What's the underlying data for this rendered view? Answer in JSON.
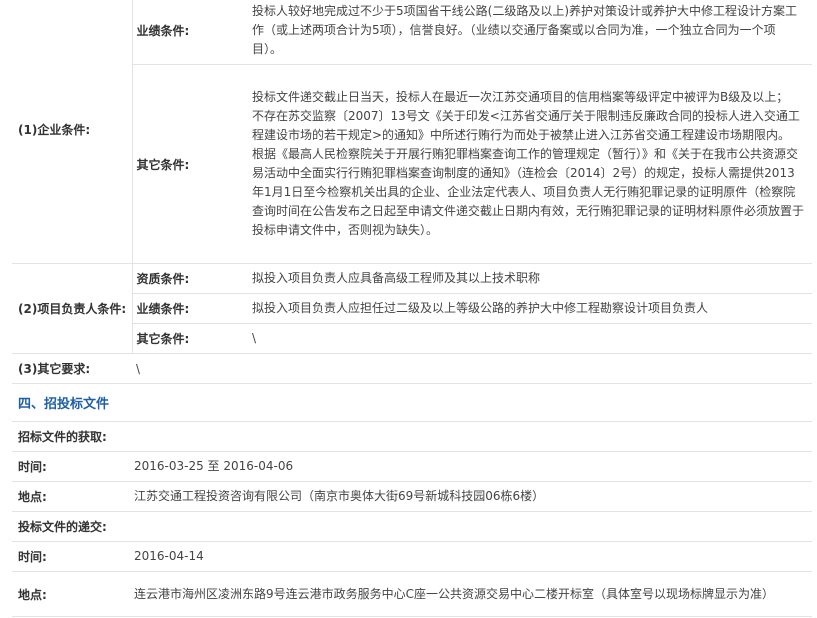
{
  "enterprise": {
    "label": "(1)企业条件:",
    "performance_label": "业绩条件:",
    "performance_text": "投标人较好地完成过不少于5项国省干线公路(二级路及以上)养护对策设计或养护大中修工程设计方案工作（或上述两项合计为5项），信誉良好。（业绩以交通厅备案或以合同为准，一个独立合同为一个项目）。",
    "other_label": "其它条件:",
    "other_text_1": "投标文件递交截止日当天，投标人在最近一次江苏交通项目的信用档案等级评定中被评为B级及以上；",
    "other_text_2": "不存在苏交监察〔2007〕13号文《关于印发<江苏省交通厅关于限制违反廉政合同的投标人进入交通工程建设市场的若干规定>的通知》中所述行贿行为而处于被禁止进入江苏省交通工程建设市场期限内。",
    "other_text_3": "根据《最高人民检察院关于开展行贿犯罪档案查询工作的管理规定（暂行）》和《关于在我市公共资源交易活动中全面实行行贿犯罪档案查询制度的通知》（连检会〔2014〕2号）的规定，投标人需提供2013年1月1日至今检察机关出具的企业、企业法定代表人、项目负责人无行贿犯罪记录的证明原件（检察院查询时间在公告发布之日起至申请文件递交截止日期内有效，无行贿犯罪记录的证明材料原件必须放置于投标申请文件中，否则视为缺失）。"
  },
  "manager": {
    "label": "(2)项目负责人条件:",
    "qual_label": "资质条件:",
    "qual_text": "拟投入项目负责人应具备高级工程师及其以上技术职称",
    "perf_label": "业绩条件:",
    "perf_text": "拟投入项目负责人应担任过二级及以上等级公路的养护大中修工程勘察设计项目负责人",
    "other_label": "其它条件:",
    "other_text": "\\"
  },
  "other_req": {
    "label": "(3)其它要求:",
    "text": "\\"
  },
  "section4": {
    "title": "四、招投标文件",
    "obtain_label": "招标文件的获取:",
    "time_label": "时间:",
    "obtain_time": "2016-03-25 至 2016-04-06",
    "place_label": "地点:",
    "obtain_place": "江苏交通工程投资咨询有限公司（南京市奥体大街69号新城科技园06栋6楼）",
    "submit_label": "投标文件的递交:",
    "submit_time": "2016-04-14",
    "submit_place": "连云港市海州区凌洲东路9号连云港市政务服务中心C座一公共资源交易中心二楼开标室（具体室号以现场标牌显示为准）"
  }
}
